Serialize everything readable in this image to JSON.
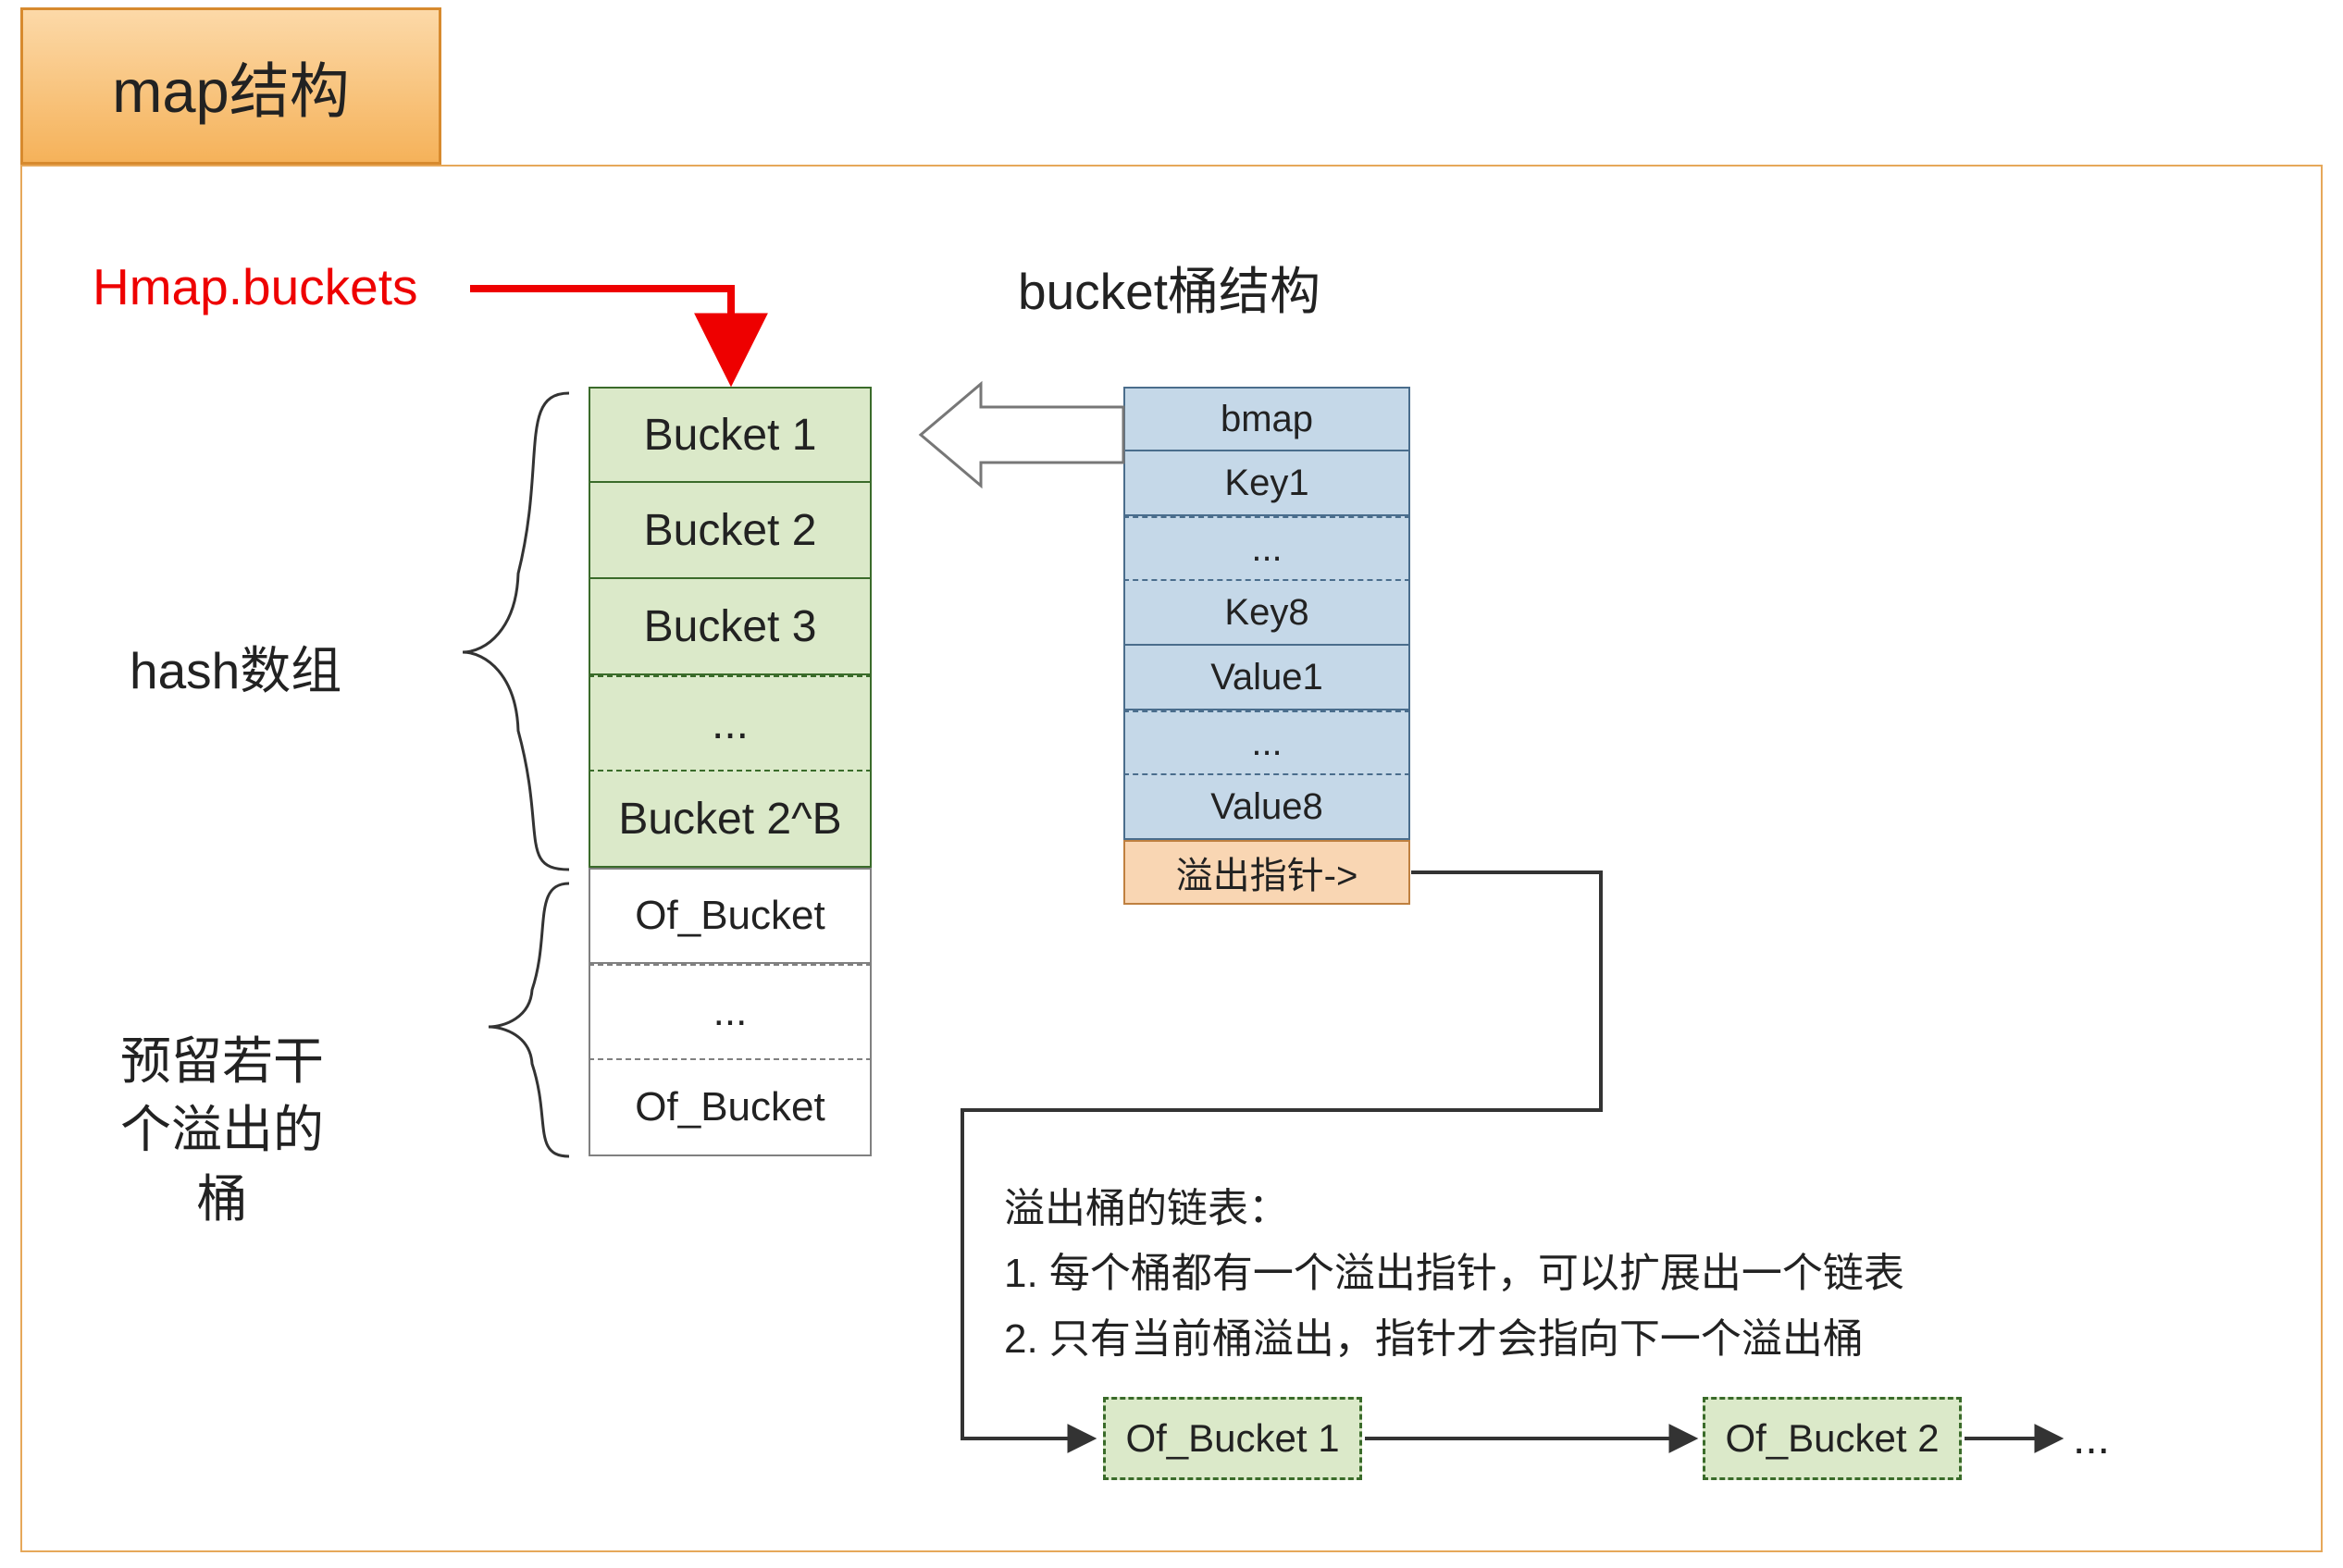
{
  "title": "map结构",
  "labels": {
    "hmap": "Hmap.buckets",
    "hash_array": "hash数组",
    "overflow_reserve": "预留若干\n个溢出的\n桶",
    "bucket_struct_title": "bucket桶结构"
  },
  "bucket_column": [
    "Bucket 1",
    "Bucket 2",
    "Bucket 3",
    "...",
    "Bucket 2^B"
  ],
  "overflow_column": [
    "Of_Bucket",
    "...",
    "Of_Bucket"
  ],
  "struct_column": {
    "blue": [
      "bmap",
      "Key1",
      "...",
      "Key8",
      "Value1",
      "...",
      "Value8"
    ],
    "overflow_ptr": "溢出指针->"
  },
  "notes": {
    "title": "溢出桶的链表：",
    "lines": [
      "1. 每个桶都有一个溢出指针，可以扩展出一个链表",
      "2. 只有当前桶溢出，指针才会指向下一个溢出桶"
    ]
  },
  "of_row": [
    "Of_Bucket 1",
    "Of_Bucket 2",
    "..."
  ],
  "chart_data": {
    "type": "table",
    "title": "Go map bucket structure diagram",
    "series": [
      {
        "name": "hash_array_buckets",
        "values": [
          "Bucket 1",
          "Bucket 2",
          "Bucket 3",
          "...",
          "Bucket 2^B"
        ]
      },
      {
        "name": "reserved_overflow_buckets",
        "values": [
          "Of_Bucket",
          "...",
          "Of_Bucket"
        ]
      },
      {
        "name": "bucket_struct_fields",
        "values": [
          "bmap",
          "Key1",
          "...",
          "Key8",
          "Value1",
          "...",
          "Value8",
          "溢出指针->"
        ]
      },
      {
        "name": "overflow_linked_list",
        "values": [
          "Of_Bucket 1",
          "Of_Bucket 2",
          "..."
        ]
      }
    ],
    "notes": [
      "溢出桶的链表：",
      "每个桶都有一个溢出指针，可以扩展出一个链表",
      "只有当前桶溢出，指针才会指向下一个溢出桶"
    ]
  }
}
